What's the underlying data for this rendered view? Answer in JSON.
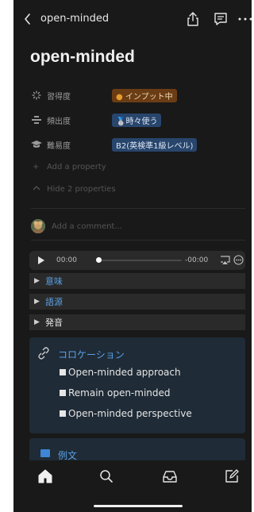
{
  "topbar": {
    "title": "open-minded",
    "icons": [
      "back-chevron-icon",
      "share-icon",
      "comment-icon",
      "more-icon"
    ]
  },
  "page": {
    "title": "open-minded"
  },
  "properties": [
    {
      "icon": "loading-icon",
      "label": "習得度",
      "value": "インプット中",
      "color": "#6b3d14"
    },
    {
      "icon": "frequency-icon",
      "label": "頻出度",
      "value": "時々使う",
      "color": "#28456c"
    },
    {
      "icon": "mortarboard-icon",
      "label": "難易度",
      "value": "B2(英検準1級レベル)",
      "color": "#28456c"
    }
  ],
  "add_property": "Add a property",
  "hide_properties": "Hide 2 properties",
  "comment_placeholder": "Add a comment...",
  "player": {
    "current": "00:00",
    "remaining": "-00:00",
    "progress": 0
  },
  "toggles": [
    {
      "label": "意味",
      "color": "#5aa0e6"
    },
    {
      "label": "語源",
      "color": "#5aa0e6"
    },
    {
      "label": "発音",
      "color": "#e6e6e6"
    }
  ],
  "callout": {
    "icon": "link-icon",
    "title": "コロケーション",
    "items": [
      "Open-minded approach",
      "Remain open-minded",
      "Open-minded perspective"
    ]
  },
  "callout2": {
    "icon": "book-icon",
    "title": "例文"
  },
  "bottom_nav": [
    "home-icon",
    "search-icon",
    "inbox-icon",
    "compose-icon"
  ]
}
